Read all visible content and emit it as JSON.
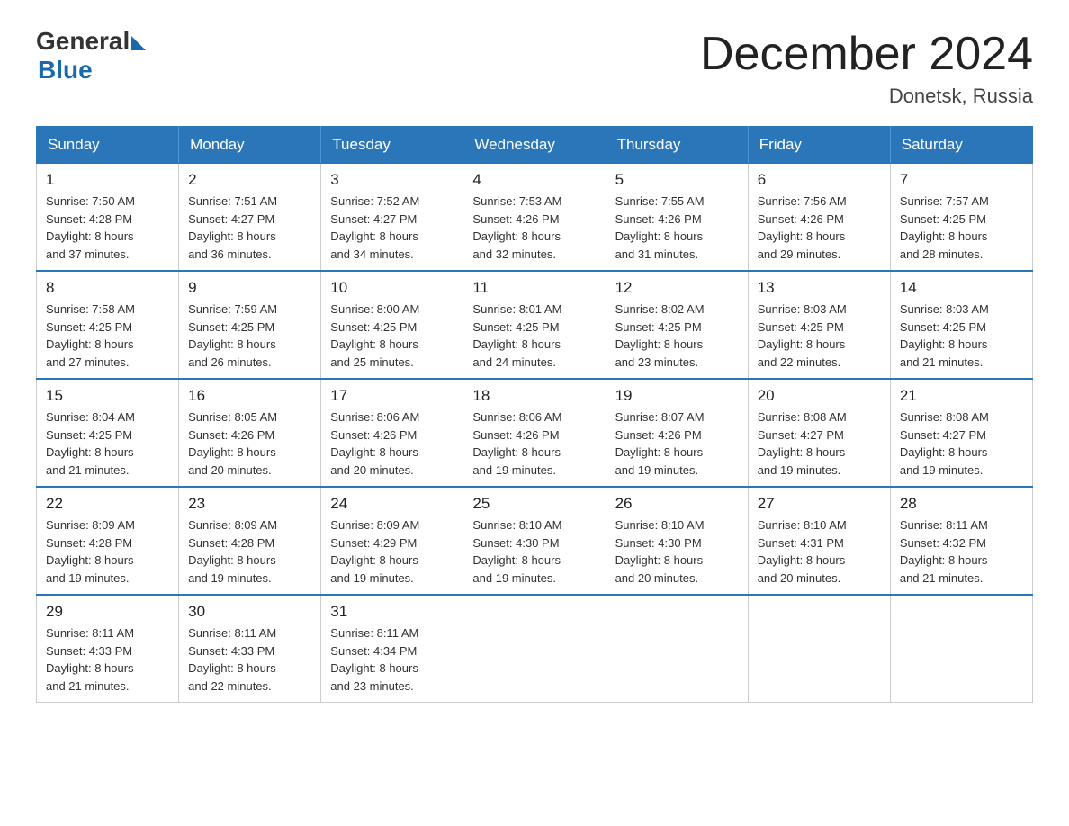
{
  "logo": {
    "general": "General",
    "blue": "Blue"
  },
  "title": "December 2024",
  "location": "Donetsk, Russia",
  "days_of_week": [
    "Sunday",
    "Monday",
    "Tuesday",
    "Wednesday",
    "Thursday",
    "Friday",
    "Saturday"
  ],
  "weeks": [
    [
      {
        "day": 1,
        "sunrise": "7:50 AM",
        "sunset": "4:28 PM",
        "daylight": "8 hours and 37 minutes."
      },
      {
        "day": 2,
        "sunrise": "7:51 AM",
        "sunset": "4:27 PM",
        "daylight": "8 hours and 36 minutes."
      },
      {
        "day": 3,
        "sunrise": "7:52 AM",
        "sunset": "4:27 PM",
        "daylight": "8 hours and 34 minutes."
      },
      {
        "day": 4,
        "sunrise": "7:53 AM",
        "sunset": "4:26 PM",
        "daylight": "8 hours and 32 minutes."
      },
      {
        "day": 5,
        "sunrise": "7:55 AM",
        "sunset": "4:26 PM",
        "daylight": "8 hours and 31 minutes."
      },
      {
        "day": 6,
        "sunrise": "7:56 AM",
        "sunset": "4:26 PM",
        "daylight": "8 hours and 29 minutes."
      },
      {
        "day": 7,
        "sunrise": "7:57 AM",
        "sunset": "4:25 PM",
        "daylight": "8 hours and 28 minutes."
      }
    ],
    [
      {
        "day": 8,
        "sunrise": "7:58 AM",
        "sunset": "4:25 PM",
        "daylight": "8 hours and 27 minutes."
      },
      {
        "day": 9,
        "sunrise": "7:59 AM",
        "sunset": "4:25 PM",
        "daylight": "8 hours and 26 minutes."
      },
      {
        "day": 10,
        "sunrise": "8:00 AM",
        "sunset": "4:25 PM",
        "daylight": "8 hours and 25 minutes."
      },
      {
        "day": 11,
        "sunrise": "8:01 AM",
        "sunset": "4:25 PM",
        "daylight": "8 hours and 24 minutes."
      },
      {
        "day": 12,
        "sunrise": "8:02 AM",
        "sunset": "4:25 PM",
        "daylight": "8 hours and 23 minutes."
      },
      {
        "day": 13,
        "sunrise": "8:03 AM",
        "sunset": "4:25 PM",
        "daylight": "8 hours and 22 minutes."
      },
      {
        "day": 14,
        "sunrise": "8:03 AM",
        "sunset": "4:25 PM",
        "daylight": "8 hours and 21 minutes."
      }
    ],
    [
      {
        "day": 15,
        "sunrise": "8:04 AM",
        "sunset": "4:25 PM",
        "daylight": "8 hours and 21 minutes."
      },
      {
        "day": 16,
        "sunrise": "8:05 AM",
        "sunset": "4:26 PM",
        "daylight": "8 hours and 20 minutes."
      },
      {
        "day": 17,
        "sunrise": "8:06 AM",
        "sunset": "4:26 PM",
        "daylight": "8 hours and 20 minutes."
      },
      {
        "day": 18,
        "sunrise": "8:06 AM",
        "sunset": "4:26 PM",
        "daylight": "8 hours and 19 minutes."
      },
      {
        "day": 19,
        "sunrise": "8:07 AM",
        "sunset": "4:26 PM",
        "daylight": "8 hours and 19 minutes."
      },
      {
        "day": 20,
        "sunrise": "8:08 AM",
        "sunset": "4:27 PM",
        "daylight": "8 hours and 19 minutes."
      },
      {
        "day": 21,
        "sunrise": "8:08 AM",
        "sunset": "4:27 PM",
        "daylight": "8 hours and 19 minutes."
      }
    ],
    [
      {
        "day": 22,
        "sunrise": "8:09 AM",
        "sunset": "4:28 PM",
        "daylight": "8 hours and 19 minutes."
      },
      {
        "day": 23,
        "sunrise": "8:09 AM",
        "sunset": "4:28 PM",
        "daylight": "8 hours and 19 minutes."
      },
      {
        "day": 24,
        "sunrise": "8:09 AM",
        "sunset": "4:29 PM",
        "daylight": "8 hours and 19 minutes."
      },
      {
        "day": 25,
        "sunrise": "8:10 AM",
        "sunset": "4:30 PM",
        "daylight": "8 hours and 19 minutes."
      },
      {
        "day": 26,
        "sunrise": "8:10 AM",
        "sunset": "4:30 PM",
        "daylight": "8 hours and 20 minutes."
      },
      {
        "day": 27,
        "sunrise": "8:10 AM",
        "sunset": "4:31 PM",
        "daylight": "8 hours and 20 minutes."
      },
      {
        "day": 28,
        "sunrise": "8:11 AM",
        "sunset": "4:32 PM",
        "daylight": "8 hours and 21 minutes."
      }
    ],
    [
      {
        "day": 29,
        "sunrise": "8:11 AM",
        "sunset": "4:33 PM",
        "daylight": "8 hours and 21 minutes."
      },
      {
        "day": 30,
        "sunrise": "8:11 AM",
        "sunset": "4:33 PM",
        "daylight": "8 hours and 22 minutes."
      },
      {
        "day": 31,
        "sunrise": "8:11 AM",
        "sunset": "4:34 PM",
        "daylight": "8 hours and 23 minutes."
      },
      null,
      null,
      null,
      null
    ]
  ]
}
